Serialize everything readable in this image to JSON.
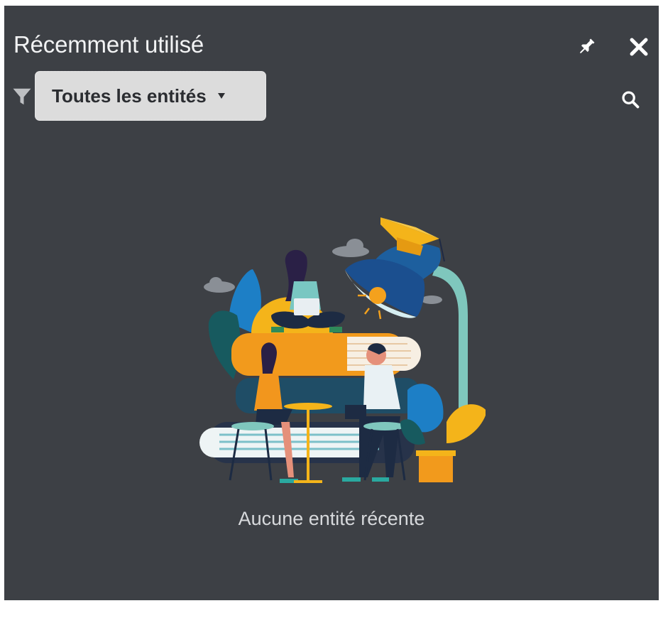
{
  "panel": {
    "title": "Récemment utilisé",
    "pin_icon": "pin-icon",
    "close_icon": "close-icon"
  },
  "filter": {
    "icon": "filter-icon",
    "dropdown_label": "Toutes les entités",
    "search_icon": "search-icon"
  },
  "empty_state": {
    "illustration": "people-studying-on-books-illustration",
    "message": "Aucune entité récente"
  },
  "colors": {
    "panel_bg": "#3d4045",
    "dropdown_bg": "#dcdcdc",
    "text_light": "#f2f3f4",
    "accent_orange": "#f4a11d",
    "accent_blue": "#1d5f9e",
    "accent_teal": "#7fc7bd"
  }
}
